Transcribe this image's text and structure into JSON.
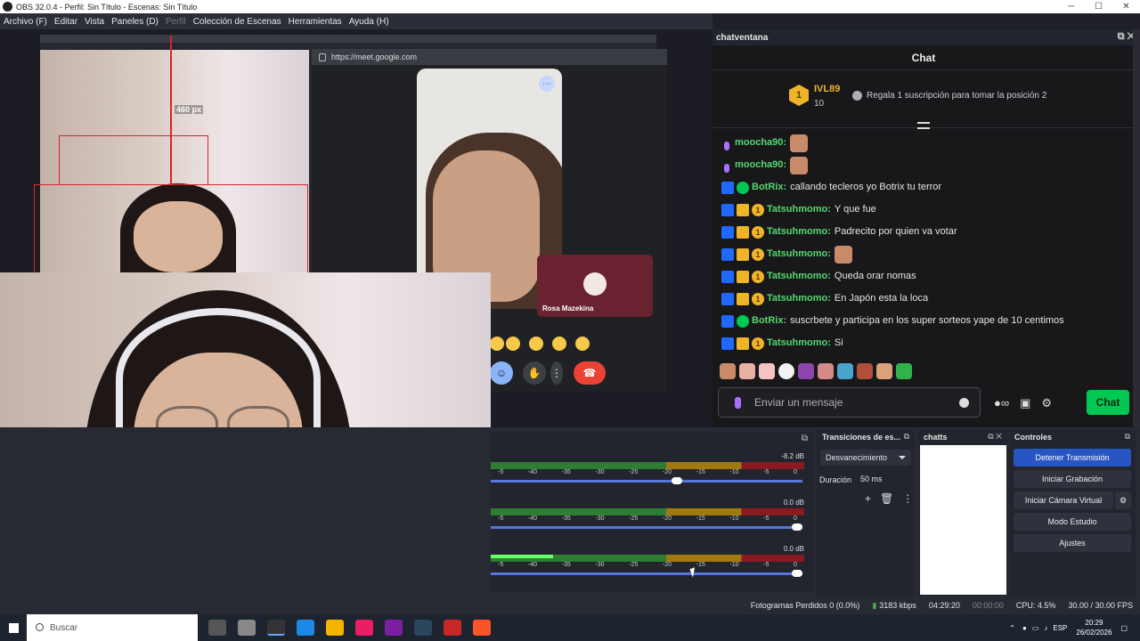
{
  "window": {
    "title": "OBS 32.0.4 - Perfil: Sin Título - Escenas: Sin Título",
    "minimize": "─",
    "maximize": "☐",
    "close": "✕"
  },
  "menu": [
    "Archivo (F)",
    "Editar",
    "Vista",
    "Paneles (D)",
    "Perfil",
    "Colección de Escenas",
    "Herramientas",
    "Ayuda (H)"
  ],
  "preview": {
    "url": "https://meet.google.com",
    "dimension_label": "460 px",
    "participant_name": "Rosa Mazekina",
    "more_icon": "⋯"
  },
  "chat_dock": {
    "dock_title": "chatventana",
    "title": "Chat",
    "leader": {
      "rank": "1",
      "name": "IVL89",
      "count": "10"
    },
    "gift_text": "Regala 1 suscripción para tomar la posición 2",
    "messages": [
      {
        "badges": [
          "mic"
        ],
        "user": "moocha90:",
        "text": "",
        "emote": true,
        "color": "#54d96d"
      },
      {
        "badges": [
          "mic"
        ],
        "user": "moocha90:",
        "text": "",
        "emote": true,
        "color": "#54d96d"
      },
      {
        "badges": [
          "pin",
          "ver"
        ],
        "user": "BotRix:",
        "text": "callando tecleros yo Botrix tu terror",
        "emote": false,
        "color": "#54d96d"
      },
      {
        "badges": [
          "pin",
          "crown",
          "one"
        ],
        "user": "Tatsuhmomo:",
        "text": "Y que fue",
        "emote": false,
        "color": "#54d96d"
      },
      {
        "badges": [
          "pin",
          "crown",
          "one"
        ],
        "user": "Tatsuhmomo:",
        "text": "Padrecito por quien va votar",
        "emote": false,
        "color": "#54d96d"
      },
      {
        "badges": [
          "pin",
          "crown",
          "one"
        ],
        "user": "Tatsuhmomo:",
        "text": "",
        "emote": true,
        "color": "#54d96d"
      },
      {
        "badges": [
          "pin",
          "crown",
          "one"
        ],
        "user": "Tatsuhmomo:",
        "text": "Queda orar nomas",
        "emote": false,
        "color": "#54d96d"
      },
      {
        "badges": [
          "pin",
          "crown",
          "one"
        ],
        "user": "Tatsuhmomo:",
        "text": "En Japón esta la loca",
        "emote": false,
        "color": "#54d96d"
      },
      {
        "badges": [
          "pin",
          "ver"
        ],
        "user": "BotRix:",
        "text": "suscrbete y participa en los super sorteos yape de 10 centimos",
        "emote": false,
        "color": "#54d96d"
      },
      {
        "badges": [
          "pin",
          "crown",
          "one"
        ],
        "user": "Tatsuhmomo:",
        "text": "Si",
        "emote": false,
        "color": "#54d96d"
      }
    ],
    "input_placeholder": "Enviar un mensaje",
    "send_label": "Chat"
  },
  "mixer": {
    "channels": [
      {
        "db": "-8.2 dB",
        "level": 0.0,
        "volume": 0.6
      },
      {
        "db": "0.0 dB",
        "level": 0.0,
        "volume": 1.0
      },
      {
        "db": "0.0 dB",
        "level": 0.2,
        "volume": 1.0
      }
    ],
    "ticks": [
      "-5",
      "-40",
      "-35",
      "-30",
      "-25",
      "-20",
      "-15",
      "-10",
      "-5",
      "0"
    ]
  },
  "transitions": {
    "title": "Transiciones de es...",
    "selected": "Desvanecimiento",
    "duration_label": "Duración",
    "duration_value": "50 ms"
  },
  "chatts": {
    "title": "chatts"
  },
  "controls": {
    "title": "Controles",
    "buttons": [
      "Detener Transmisión",
      "Iniciar Grabación",
      "Iniciar Cámara Virtual",
      "Modo Estudio",
      "Ajustes"
    ]
  },
  "status": {
    "dropped": "Fotogramas Perdidos 0 (0.0%)",
    "bitrate": "3183 kbps",
    "stream_time": "04:29:20",
    "rec_time": "00:00:00",
    "cpu": "CPU: 4.5%",
    "fps": "30.00 / 30.00 FPS"
  },
  "taskbar": {
    "search": "Buscar",
    "lang": "ESP",
    "time": "20:29",
    "date": "26/02/2026"
  },
  "colors": {
    "accent": "#2855c4",
    "chat_green": "#00c853",
    "twitch_purple": "#a970ff",
    "gold": "#f0b429"
  }
}
